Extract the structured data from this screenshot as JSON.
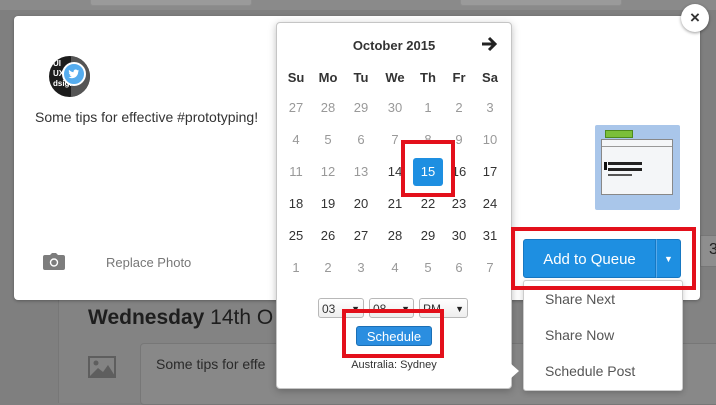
{
  "background": {
    "heading_bold": "Wednesday",
    "heading_rest": " 14th O",
    "box_text": "Some tips for effe",
    "right_number": "3"
  },
  "composer": {
    "close_glyph": "×",
    "avatar_text": "UI\nUX\ndsign",
    "post_text": "Some tips for effective #prototyping!",
    "replace_photo_label": "Replace Photo"
  },
  "datepicker": {
    "month_label": "October 2015",
    "weekdays": [
      "Su",
      "Mo",
      "Tu",
      "We",
      "Th",
      "Fr",
      "Sa"
    ],
    "weeks": [
      [
        {
          "d": "27",
          "muted": true
        },
        {
          "d": "28",
          "muted": true
        },
        {
          "d": "29",
          "muted": true
        },
        {
          "d": "30",
          "muted": true
        },
        {
          "d": "1",
          "muted": true
        },
        {
          "d": "2",
          "muted": true
        },
        {
          "d": "3",
          "muted": true
        }
      ],
      [
        {
          "d": "4",
          "muted": true
        },
        {
          "d": "5",
          "muted": true
        },
        {
          "d": "6",
          "muted": true
        },
        {
          "d": "7",
          "muted": true
        },
        {
          "d": "8",
          "muted": true
        },
        {
          "d": "9",
          "muted": true
        },
        {
          "d": "10",
          "muted": true
        }
      ],
      [
        {
          "d": "11",
          "muted": true
        },
        {
          "d": "12",
          "muted": true
        },
        {
          "d": "13",
          "muted": true
        },
        {
          "d": "14",
          "muted": false
        },
        {
          "d": "15",
          "selected": true
        },
        {
          "d": "16",
          "muted": false
        },
        {
          "d": "17",
          "muted": false
        }
      ],
      [
        {
          "d": "18"
        },
        {
          "d": "19"
        },
        {
          "d": "20"
        },
        {
          "d": "21"
        },
        {
          "d": "22"
        },
        {
          "d": "23"
        },
        {
          "d": "24"
        }
      ],
      [
        {
          "d": "25"
        },
        {
          "d": "26"
        },
        {
          "d": "27"
        },
        {
          "d": "28"
        },
        {
          "d": "29"
        },
        {
          "d": "30"
        },
        {
          "d": "31"
        }
      ],
      [
        {
          "d": "1",
          "muted": true
        },
        {
          "d": "2",
          "muted": true
        },
        {
          "d": "3",
          "muted": true
        },
        {
          "d": "4",
          "muted": true
        },
        {
          "d": "5",
          "muted": true
        },
        {
          "d": "6",
          "muted": true
        },
        {
          "d": "7",
          "muted": true
        }
      ]
    ],
    "hour": "03",
    "minute": "08",
    "ampm": "PM",
    "schedule_label": "Schedule",
    "timezone": "Australia: Sydney",
    "selected_color": "#1e8fe1"
  },
  "queue": {
    "add_label": "Add to Queue",
    "menu": [
      "Share Next",
      "Share Now",
      "Schedule Post"
    ],
    "button_color": "#1e8fe1"
  },
  "annotation_color": "#e3101b"
}
